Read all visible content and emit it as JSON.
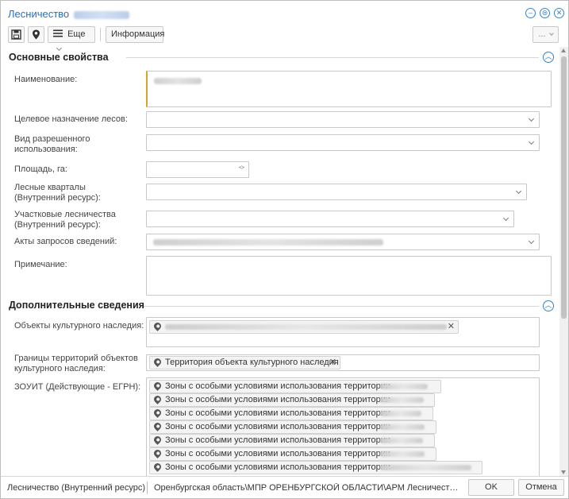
{
  "window": {
    "title": "Лесничество",
    "title_name_redacted": ""
  },
  "toolbar": {
    "more_label": "Еще",
    "info_label": "Информация",
    "overflow_label": "..."
  },
  "main_section": {
    "title": "Основные свойства",
    "fields": {
      "name_label": "Наименование:",
      "purpose_label": "Целевое назначение лесов:",
      "usage_label": "Вид разрешенного использования:",
      "area_label": "Площадь, га:",
      "quarters_label": "Лесные кварталы (Внутренний ресурс):",
      "districts_label": "Участковые лесничества (Внутренний ресурс):",
      "requests_label": "Акты запросов сведений:",
      "note_label": "Примечание:"
    }
  },
  "extra_section": {
    "title": "Дополнительные сведения",
    "heritage_label": "Объекты культурного наследия:",
    "borders_label": "Границы территорий объектов культурного наследия:",
    "borders_tag": "Территория объекта культурного наследия",
    "zouit_label": "ЗОУИТ (Действующие - ЕГРН):",
    "zouit_items": [
      "Зоны с особыми условиями использования территории",
      "Зоны с особыми условиями использования территории",
      "Зоны с особыми условиями использования территории",
      "Зоны с особыми условиями использования территории",
      "Зоны с особыми условиями использования территории",
      "Зоны с особыми условиями использования территории",
      "Зоны с особыми условиями использования территории"
    ]
  },
  "footer": {
    "resource": "Лесничество (Внутренний ресурс)",
    "path": "Оренбургская область\\МПР ОРЕНБУРГСКОЙ ОБЛАСТИ\\АРМ Лесничества\\...",
    "ok_label": "OK",
    "cancel_label": "Отмена"
  },
  "colors": {
    "accent": "#2a6fbf",
    "required_marker": "#e0a226"
  },
  "icons": {
    "save": "save-icon",
    "location": "map-pin-icon",
    "menu": "menu-icon",
    "minimize": "minimize-icon",
    "restore": "restore-icon",
    "close": "close-icon",
    "collapse": "chevron-up-icon"
  }
}
